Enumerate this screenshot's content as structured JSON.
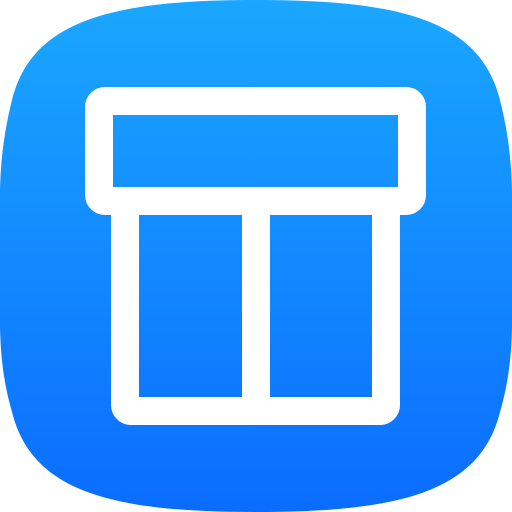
{
  "icon": {
    "name": "table-layout-icon",
    "background_gradient_top": "#1aa7ff",
    "background_gradient_bottom": "#0b6cff",
    "glyph_color": "#ffffff"
  }
}
